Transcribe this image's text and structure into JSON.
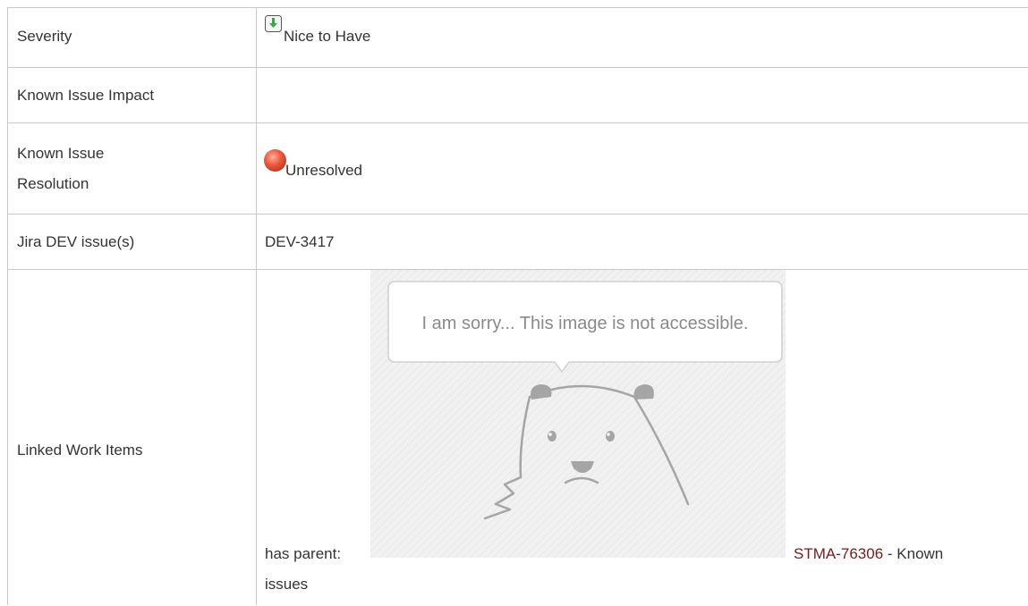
{
  "rows": [
    {
      "label": "Severity",
      "value": "Nice to Have",
      "icon": "severity-nice-to-have-icon",
      "icon_color": "#33aa44"
    },
    {
      "label": "Known Issue Impact",
      "value": ""
    },
    {
      "label_line1": "Known Issue",
      "label_line2": "Resolution",
      "value": "Unresolved",
      "icon": "unresolved-status-icon",
      "icon_color": "#e8553a"
    },
    {
      "label": "Jira DEV issue(s)",
      "value": "DEV-3417"
    },
    {
      "label": "Linked Work Items",
      "prefix": "has parent:",
      "image_message": "I am sorry... This image is not accessible.",
      "link_text": "STMA-76306",
      "link_suffix": " - Known",
      "link_suffix_line2": "issues"
    }
  ],
  "colors": {
    "border": "#c8c8c8",
    "link": "#7a1a1a",
    "text": "#333333"
  }
}
